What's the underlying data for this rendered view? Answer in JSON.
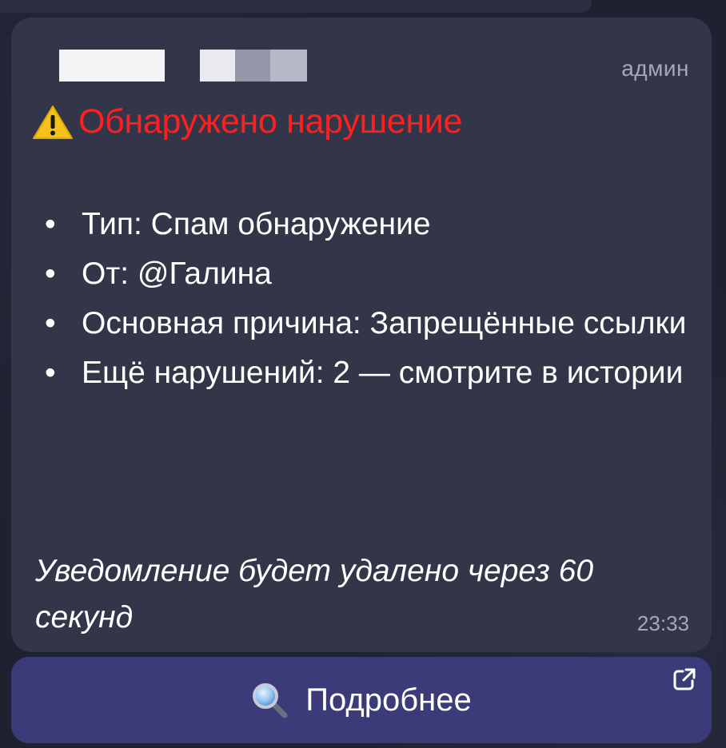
{
  "message": {
    "role_badge": "админ",
    "alert": {
      "icon": "warning-triangle-icon",
      "title": "Обнаружено нарушение",
      "title_color": "#ff1f1f"
    },
    "details": [
      {
        "bullet": "•",
        "text": "Тип: Спам обнаружение"
      },
      {
        "bullet": "•",
        "text": "От: @Галина"
      },
      {
        "bullet": "•",
        "text": "Основная причина: Запрещённые ссылки"
      },
      {
        "bullet": "•",
        "text": "Ещё нарушений: 2 — смотрите в истории"
      }
    ],
    "notice": "Уведомление будет удалено через 60 секунд",
    "time": "23:33"
  },
  "inline_button": {
    "icon": "magnifier-icon",
    "label": "Подробнее",
    "corner_icon": "external-link-icon"
  },
  "colors": {
    "bubble": "#333649",
    "button": "#3b3b7a",
    "meta_text": "#a6a8b8"
  }
}
